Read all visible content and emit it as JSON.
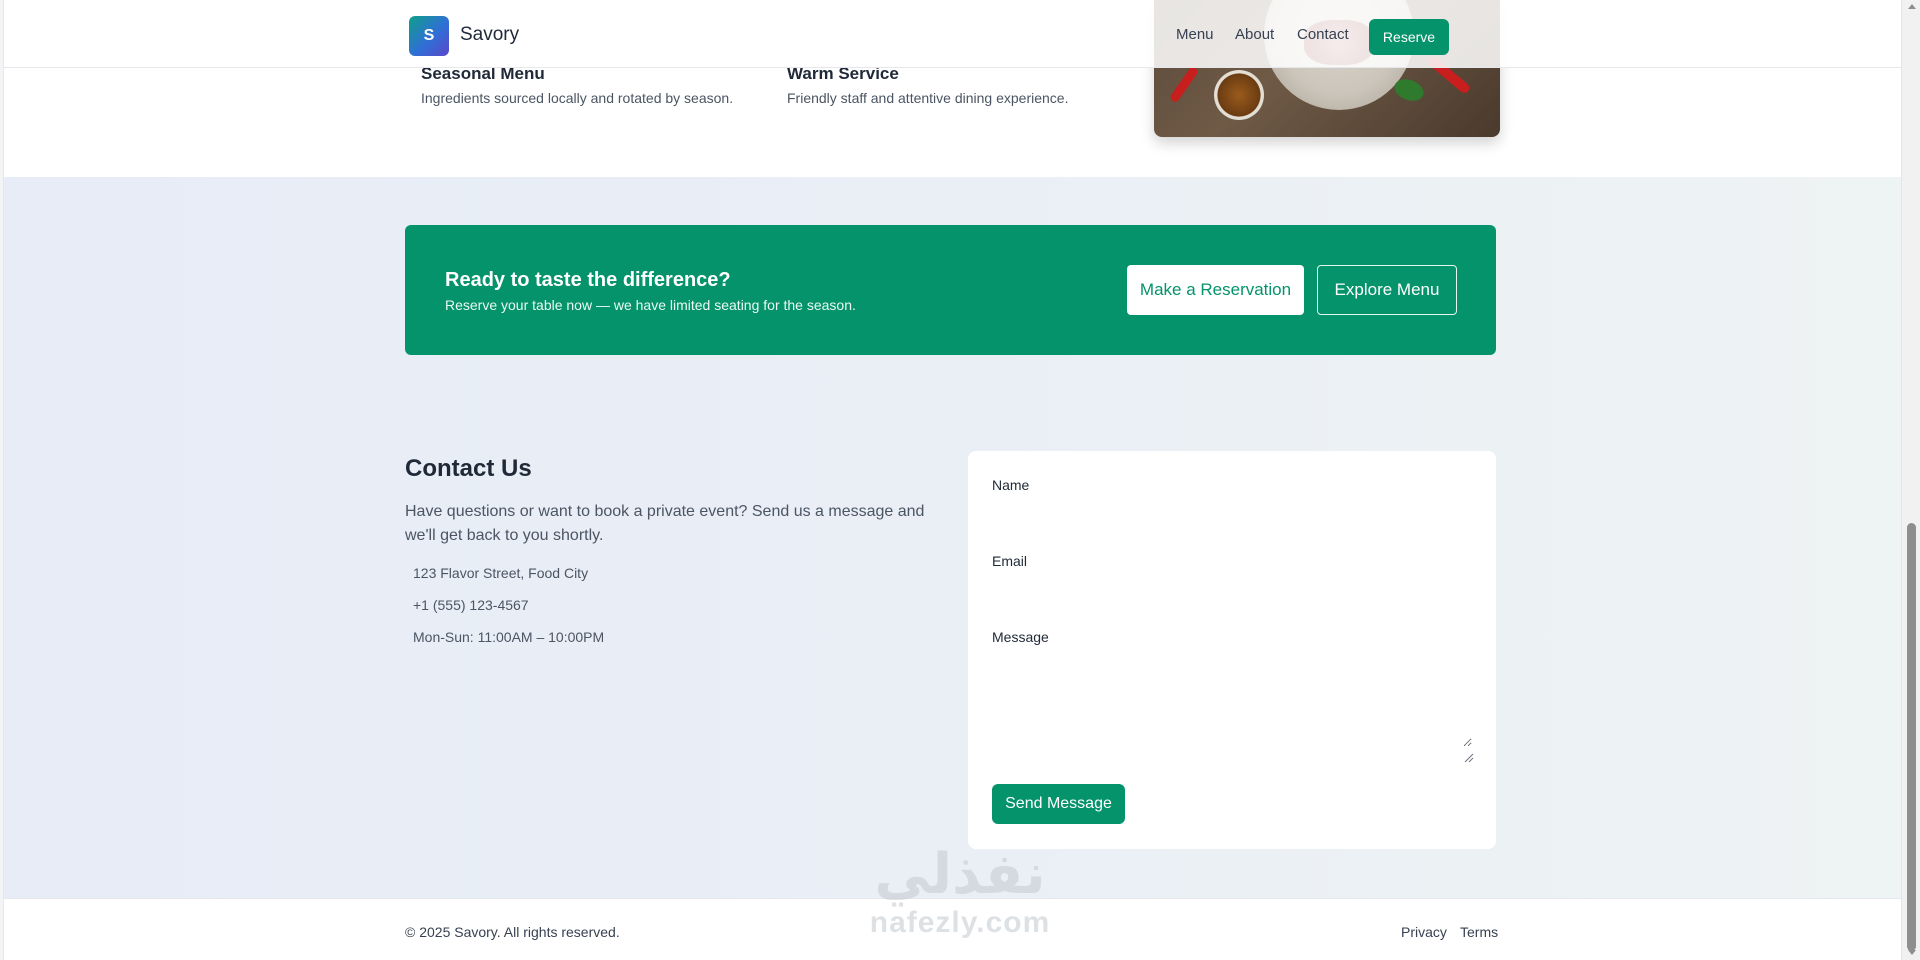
{
  "navbar": {
    "logo_letter": "S",
    "brand": "Savory",
    "links": [
      "Menu",
      "About",
      "Contact"
    ],
    "reserve_label": "Reserve"
  },
  "about": {
    "features": [
      {
        "title": "Seasonal Menu",
        "description": "Ingredients sourced locally and rotated by season."
      },
      {
        "title": "Warm Service",
        "description": "Friendly staff and attentive dining experience."
      }
    ]
  },
  "cta": {
    "title": "Ready to taste the difference?",
    "subtitle": "Reserve your table now — we have limited seating for the season.",
    "primary_label": "Make a Reservation",
    "secondary_label": "Explore Menu"
  },
  "contact": {
    "title": "Contact Us",
    "description": "Have questions or want to book a private event? Send us a message and we'll get back to you shortly.",
    "address": "123 Flavor Street, Food City",
    "phone": "+1 (555) 123-4567",
    "hours": "Mon-Sun: 11:00AM – 10:00PM"
  },
  "form": {
    "name_label": "Name",
    "email_label": "Email",
    "message_label": "Message",
    "name_value": "",
    "email_value": "",
    "message_value": "",
    "submit_label": "Send Message"
  },
  "footer": {
    "copyright": "© 2025 Savory. All rights reserved.",
    "links": [
      "Privacy",
      "Terms"
    ]
  },
  "watermark": {
    "arabic": "نفذلي",
    "latin": "nafezly.com"
  },
  "colors": {
    "brand_green": "#04936a",
    "section_tint": "#e9eef7"
  }
}
